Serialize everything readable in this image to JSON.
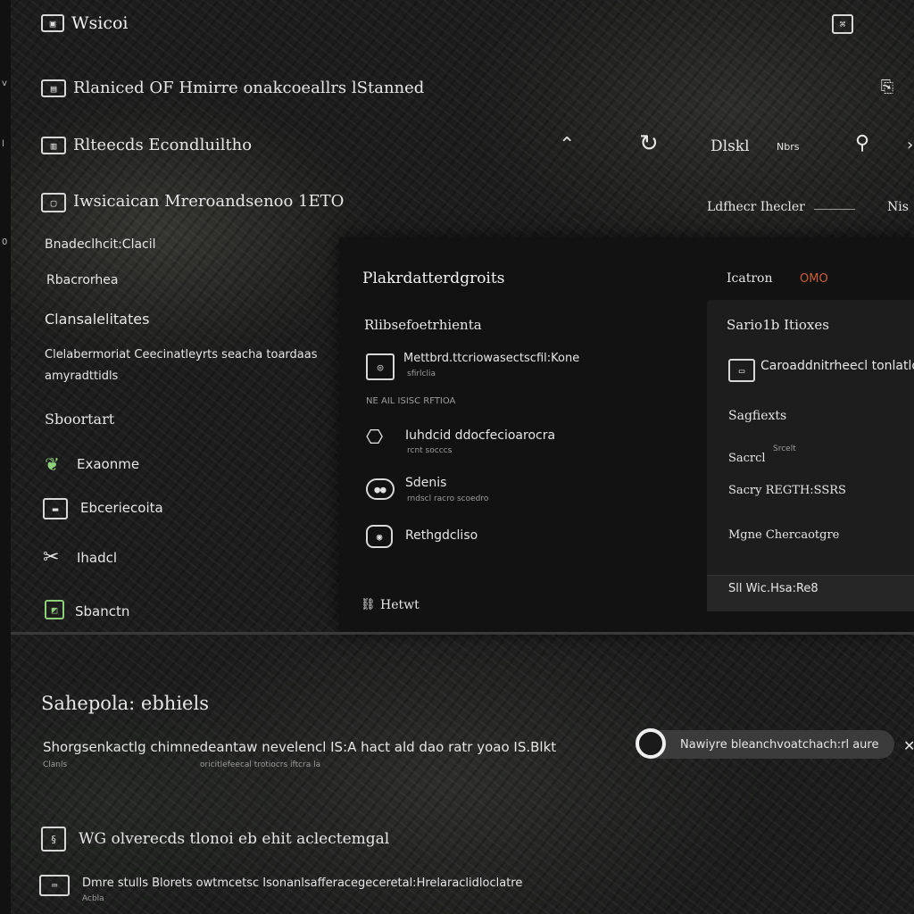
{
  "app": {
    "title": "Wsicoi"
  },
  "left_edge": {
    "marks": [
      "v",
      "l",
      "0"
    ]
  },
  "header_rows": [
    {
      "label": "Rlaniced OF Hmirre onakcoeallrs lStanned"
    },
    {
      "label": "Rlteecds Econdluiltho"
    },
    {
      "label": "Iwsicaican Mreroandsenoo 1ETO"
    }
  ],
  "toolbar": {
    "label_1": "Dlskl",
    "label_2": "Nbrs",
    "right_label": "Ldfhecr Ihecler",
    "right_tail": "Nis"
  },
  "sidebar": {
    "heading_1": "Bnadeclhcit:Clacil",
    "heading_2": "Rbacrorhea",
    "heading_3": "Clansalelitates",
    "description_line_1": "Clelabermoriat Ceecinatleyrts seacha toardaas",
    "description_line_2": "amyradttidls",
    "section_title": "Sboortart",
    "items": [
      {
        "label": "Exaonme"
      },
      {
        "label": "Ebceriecoita"
      },
      {
        "label": "Ihadcl"
      },
      {
        "label": "Sbanctn"
      }
    ]
  },
  "panel": {
    "title": "Plakrdatterdgroits",
    "top_right_label": "Icatron",
    "top_right_badge": "OMO",
    "subtitle": "Rlibsefoetrhienta",
    "items": [
      {
        "title": "Mettbrd.ttcriowasectscfil:Kone",
        "meta": "sfirlclia"
      },
      {
        "title": "Iuhdcid ddocfecioarocra",
        "meta": "rcnt socccs"
      },
      {
        "title": "Sdenis",
        "meta": "rndscl racro scoedro"
      },
      {
        "title": "Rethgdcliso",
        "meta": ""
      }
    ],
    "small_row": "NE AIL ISISC RFTIOA",
    "footer": "Hetwt"
  },
  "subpanel": {
    "title": "Sario1b Itioxes",
    "feature": "Caroaddnitrheecl tonlatlo",
    "rows": [
      {
        "label": "Sagfiexts"
      },
      {
        "label": "Sacrcl",
        "note": "Srcelt"
      },
      {
        "label": "Sacry REGTH:SSRS"
      },
      {
        "label": "Mgne Chercaotgre"
      }
    ],
    "footer": "Sll Wic.Hsa:Re8"
  },
  "lower": {
    "heading": "Sahepola: ebhiels",
    "description": "Shorgsenkactlg chimnedeantaw nevelencl IS:A hact ald dao ratr yoao IS.Blkt",
    "description_meta": "Clanls",
    "description_meta_2": "oricitlefeecal trotiocrs iftcra la",
    "toggle_label": "Nawiyre bleanchvoatchach:rl aure",
    "row_1": "WG olverecds tlonoi eb  ehit  aclectemgal",
    "row_2": "Dmre stulls Blorets owtmcetsc Isonanlsafferacegeceretal:Hrelaraclidloclatre",
    "row_2_meta": "Acbla"
  }
}
